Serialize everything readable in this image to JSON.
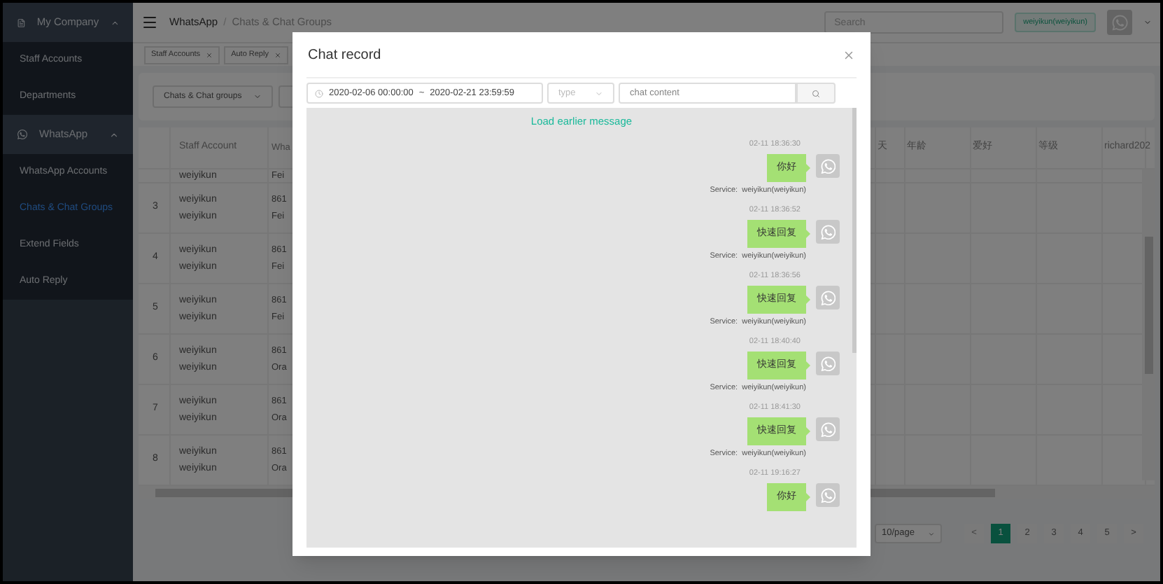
{
  "sidebar": {
    "sections": [
      {
        "title": "My Company",
        "expanded": true,
        "items": [
          {
            "label": "Staff Accounts",
            "selected": false
          },
          {
            "label": "Departments",
            "selected": false
          }
        ]
      },
      {
        "title": "WhatsApp",
        "expanded": true,
        "items": [
          {
            "label": "WhatsApp Accounts",
            "selected": false
          },
          {
            "label": "Chats & Chat Groups",
            "selected": true
          },
          {
            "label": "Extend Fields",
            "selected": false
          },
          {
            "label": "Auto Reply",
            "selected": false
          }
        ]
      }
    ]
  },
  "header": {
    "breadcrumb": [
      "WhatsApp",
      "Chats & Chat Groups"
    ],
    "breadcrumb_separator": "/",
    "search": {
      "placeholder": "Search"
    },
    "user": "weiyikun(weiyikun)"
  },
  "tags": [
    {
      "label": "Staff Accounts"
    },
    {
      "label": "Auto Reply"
    }
  ],
  "filters": {
    "select": "Chats & Chat groups"
  },
  "table": {
    "left_columns": [
      "",
      "Staff Account",
      "Wha"
    ],
    "right_columns": [
      "天",
      "年龄",
      "爱好",
      "等级",
      "richard202"
    ],
    "rows": [
      {
        "index": "",
        "staff": [
          "weiyikun"
        ],
        "whatsapp": [
          "Fei"
        ]
      },
      {
        "index": "3",
        "staff": [
          "weiyikun",
          "weiyikun"
        ],
        "whatsapp": [
          "861",
          "Fei"
        ]
      },
      {
        "index": "4",
        "staff": [
          "weiyikun",
          "weiyikun"
        ],
        "whatsapp": [
          "861",
          "Fei"
        ]
      },
      {
        "index": "5",
        "staff": [
          "weiyikun",
          "weiyikun"
        ],
        "whatsapp": [
          "861",
          "Fei"
        ]
      },
      {
        "index": "6",
        "staff": [
          "weiyikun",
          "weiyikun"
        ],
        "whatsapp": [
          "861",
          "Ora"
        ]
      },
      {
        "index": "7",
        "staff": [
          "weiyikun",
          "weiyikun"
        ],
        "whatsapp": [
          "861",
          "Ora"
        ]
      },
      {
        "index": "8",
        "staff": [
          "weiyikun",
          "weiyikun"
        ],
        "whatsapp": [
          "861",
          "Ora"
        ]
      }
    ]
  },
  "pagination": {
    "page_size": "10/page",
    "prev": "<",
    "next": ">",
    "pages": [
      {
        "label": "1",
        "selected": true
      },
      {
        "label": "2",
        "selected": false
      },
      {
        "label": "3",
        "selected": false
      },
      {
        "label": "4",
        "selected": false
      },
      {
        "label": "5",
        "selected": false
      }
    ]
  },
  "modal": {
    "title": "Chat record",
    "date_start": "2020-02-06 00:00:00",
    "date_sep": "~",
    "date_end": "2020-02-21 23:59:59",
    "type_placeholder": "type",
    "content_placeholder": "chat content",
    "load_more": "Load earlier message",
    "messages": [
      {
        "time": "02-11 18:36:30",
        "text": "你好",
        "service_label": "Service:",
        "service": "weiyikun(weiyikun)"
      },
      {
        "time": "02-11 18:36:52",
        "text": "快速回复",
        "service_label": "Service:",
        "service": "weiyikun(weiyikun)"
      },
      {
        "time": "02-11 18:36:56",
        "text": "快速回复",
        "service_label": "Service:",
        "service": "weiyikun(weiyikun)"
      },
      {
        "time": "02-11 18:40:40",
        "text": "快速回复",
        "service_label": "Service:",
        "service": "weiyikun(weiyikun)"
      },
      {
        "time": "02-11 18:41:30",
        "text": "快速回复",
        "service_label": "Service:",
        "service": "weiyikun(weiyikun)"
      },
      {
        "time": "02-11 19:16:27",
        "text": "你好"
      }
    ]
  }
}
